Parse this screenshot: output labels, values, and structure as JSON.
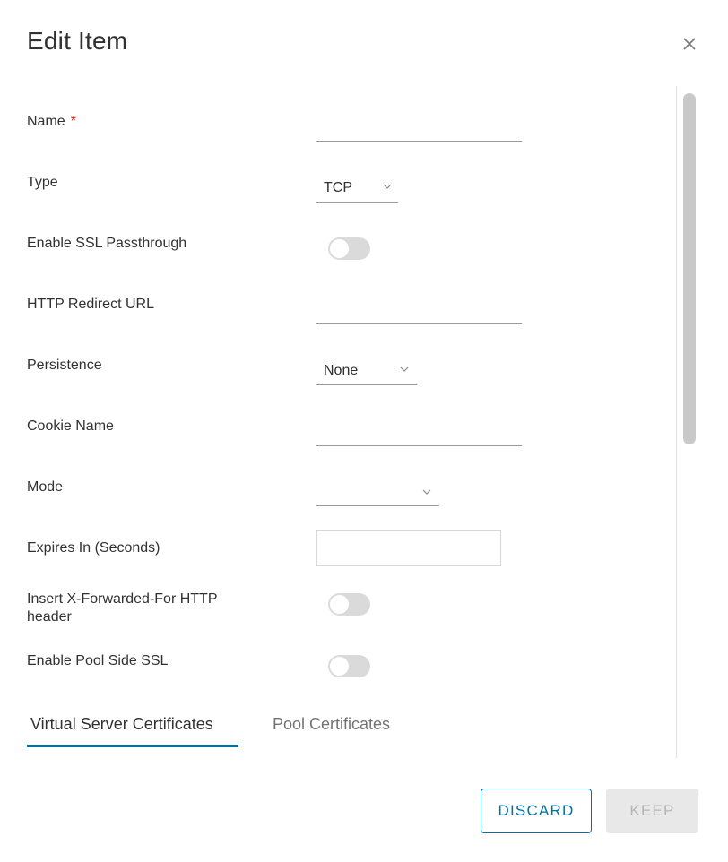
{
  "dialog": {
    "title": "Edit Item",
    "close_icon": "close-icon"
  },
  "fields": {
    "name": {
      "label": "Name",
      "required_mark": "*",
      "value": ""
    },
    "type": {
      "label": "Type",
      "selected": "TCP"
    },
    "ssl_passthrough": {
      "label": "Enable SSL Passthrough",
      "enabled": false
    },
    "http_redirect": {
      "label": "HTTP Redirect URL",
      "value": ""
    },
    "persistence": {
      "label": "Persistence",
      "selected": "None"
    },
    "cookie_name": {
      "label": "Cookie Name",
      "value": ""
    },
    "mode": {
      "label": "Mode",
      "selected": ""
    },
    "expires": {
      "label": "Expires In (Seconds)",
      "value": ""
    },
    "x_forwarded": {
      "label_line1": "Insert X-Forwarded-For HTTP",
      "label_line2": "header",
      "enabled": false
    },
    "pool_ssl": {
      "label": "Enable Pool Side SSL",
      "enabled": false
    }
  },
  "tabs": [
    {
      "label": "Virtual Server Certificates",
      "active": true
    },
    {
      "label": "Pool Certificates",
      "active": false
    }
  ],
  "footer": {
    "discard_label": "DISCARD",
    "keep_label": "KEEP"
  },
  "colors": {
    "accent": "#0072a3",
    "required": "#c92100",
    "toggle_off": "#dadada",
    "disabled_button": "#e8e8e8"
  }
}
